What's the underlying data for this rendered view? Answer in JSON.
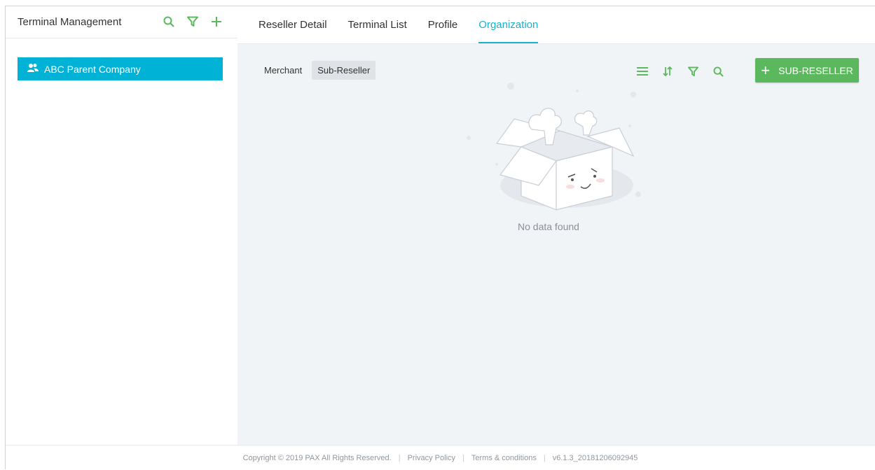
{
  "left": {
    "title": "Terminal Management",
    "tree": [
      {
        "label": "ABC Parent Company"
      }
    ]
  },
  "tabs": [
    {
      "label": "Reseller Detail"
    },
    {
      "label": "Terminal List"
    },
    {
      "label": "Profile"
    },
    {
      "label": "Organization",
      "active": true
    }
  ],
  "subtabs": [
    {
      "label": "Merchant"
    },
    {
      "label": "Sub-Reseller",
      "active": true
    }
  ],
  "toolbar": {
    "add_label": "SUB-RESELLER",
    "icons": [
      "list-icon",
      "sort-icon",
      "filter-icon",
      "search-icon"
    ]
  },
  "empty": {
    "message": "No data found"
  },
  "footer": {
    "copyright": "Copyright © 2019 PAX All Rights Reserved.",
    "privacy": "Privacy Policy",
    "terms": "Terms & conditions",
    "version": "v6.1.3_20181206092945"
  },
  "colors": {
    "accent_green": "#5cb85c",
    "tab_active": "#1ab1c9",
    "tree_selected": "#00b3d6"
  }
}
